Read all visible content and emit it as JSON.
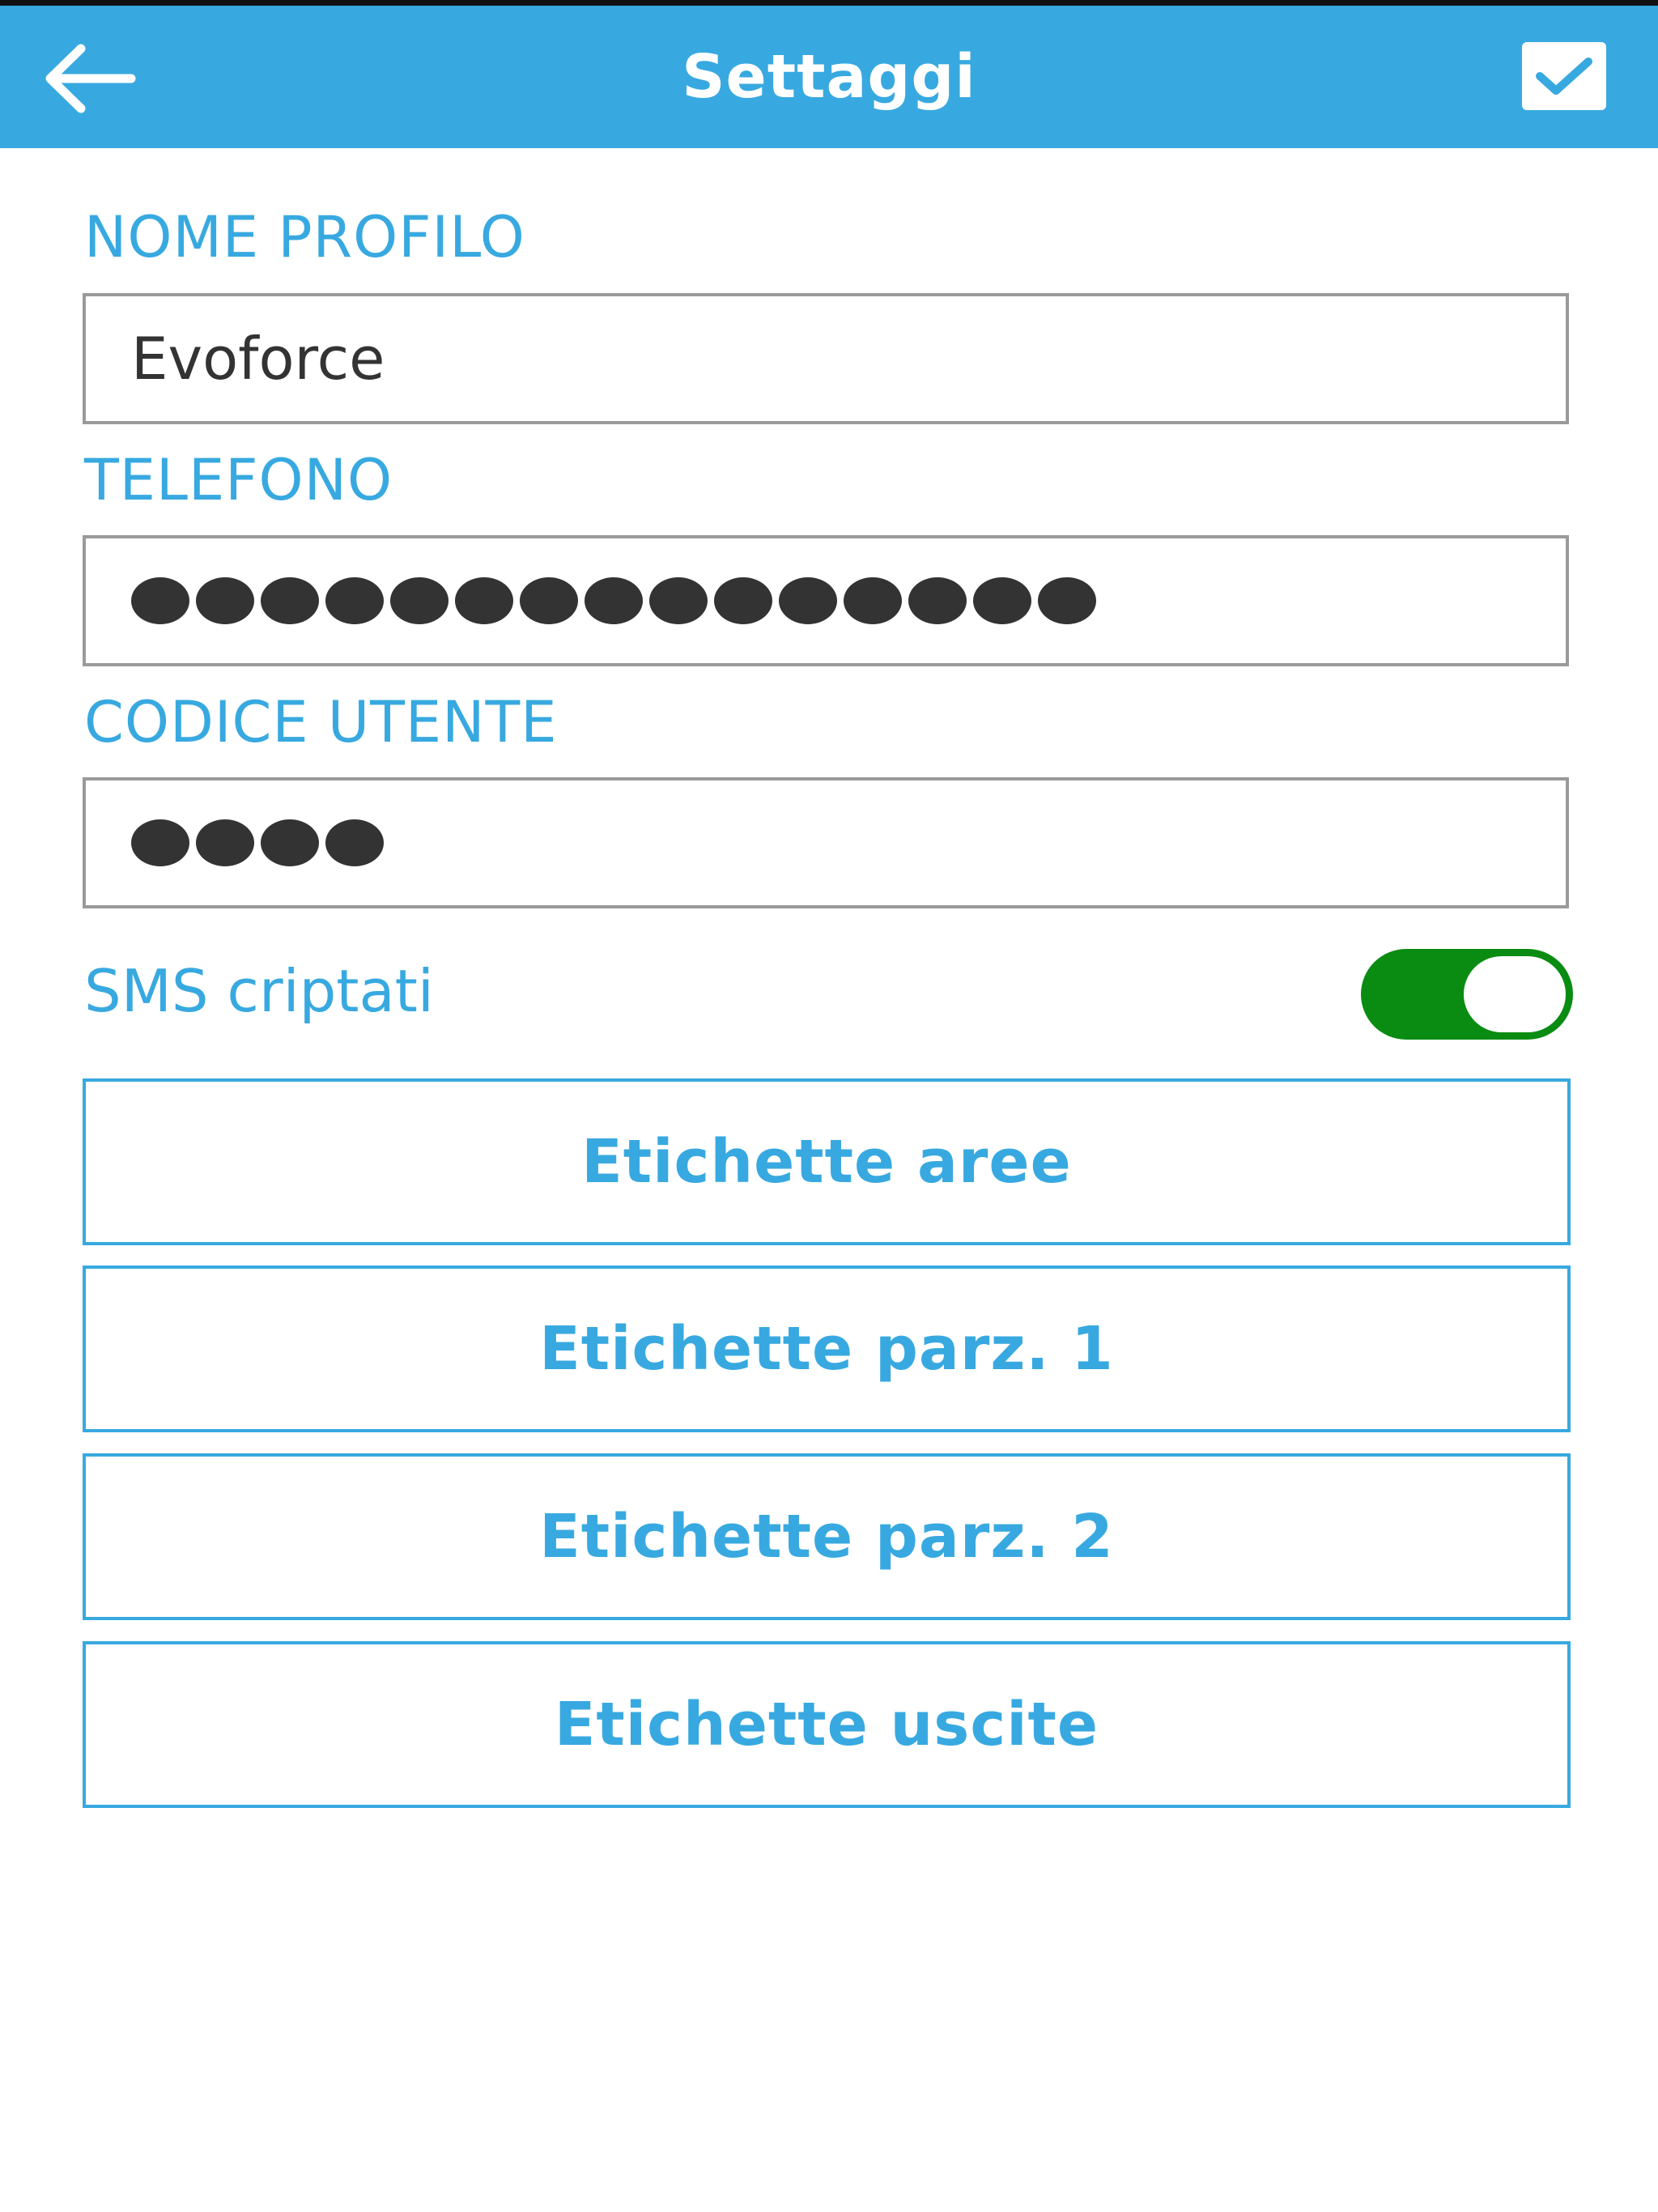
{
  "header": {
    "title": "Settaggi",
    "color": "#38a9e0"
  },
  "profile": {
    "label": "NOME PROFILO",
    "value": "Evoforce"
  },
  "phone": {
    "label": "TELEFONO",
    "masked_length": 15
  },
  "user_code": {
    "label": "CODICE UTENTE",
    "masked_length": 4
  },
  "sms": {
    "label": "SMS criptati",
    "enabled": true,
    "toggle_color": "#0a8c12"
  },
  "buttons": {
    "areas": "Etichette aree",
    "partial1": "Etichette parz. 1",
    "partial2": "Etichette parz. 2",
    "outputs": "Etichette uscite"
  },
  "icons": {
    "back": "arrow-left-icon",
    "confirm": "checkbox-check-icon"
  }
}
